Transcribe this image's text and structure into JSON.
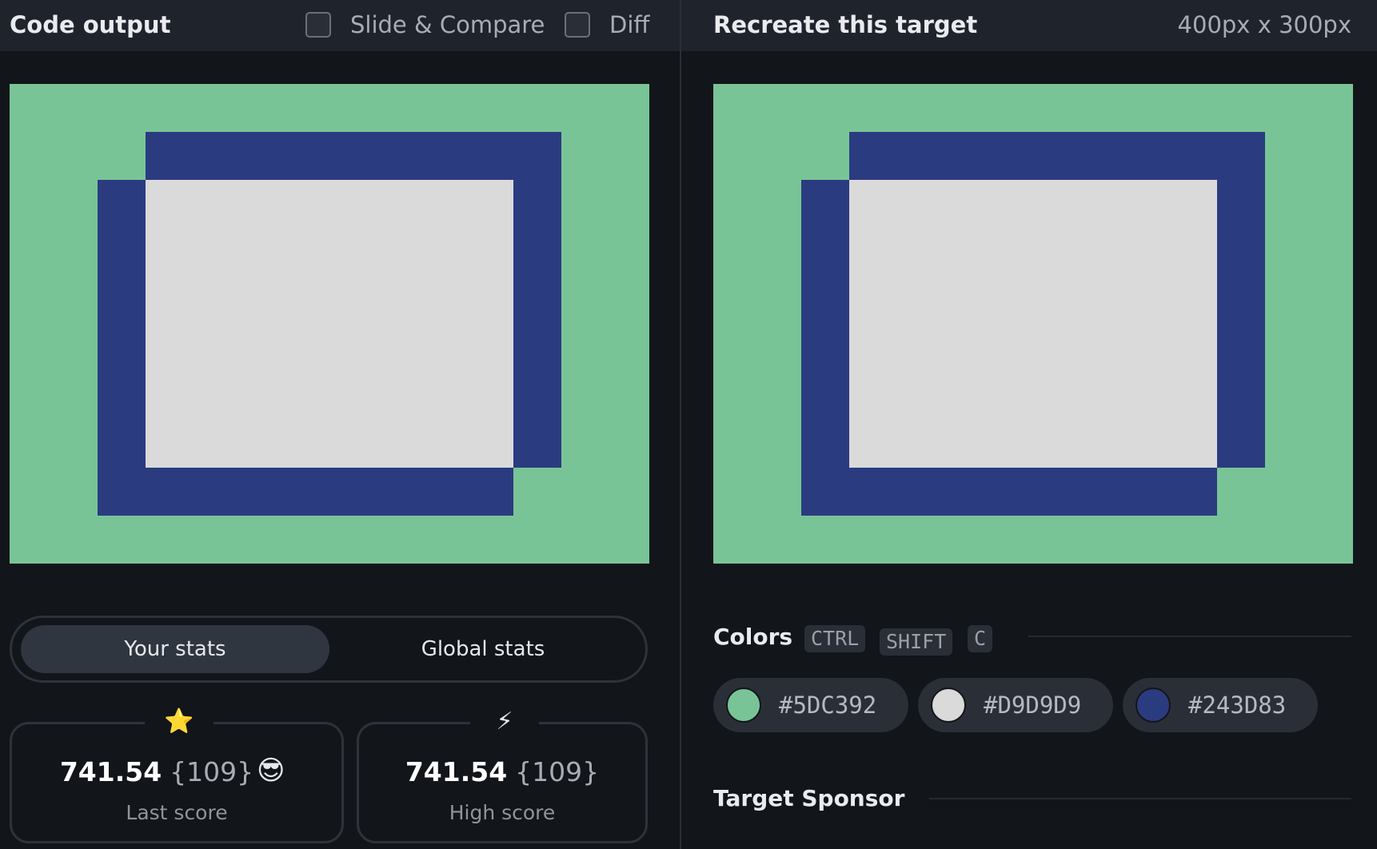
{
  "left": {
    "title": "Code output",
    "slide_compare_label": "Slide & Compare",
    "diff_label": "Diff"
  },
  "right": {
    "title": "Recreate this target",
    "dimensions": "400px x 300px"
  },
  "stats": {
    "tabs": {
      "your": "Your stats",
      "global": "Global stats"
    },
    "last": {
      "icon": "star-icon",
      "glyph": "⭐",
      "value": "741.54",
      "count": "{109}",
      "emoji": "😎",
      "label": "Last score"
    },
    "high": {
      "icon": "lightning-icon",
      "glyph": "⚡",
      "value": "741.54",
      "count": "{109}",
      "label": "High score"
    }
  },
  "colors": {
    "title": "Colors",
    "shortcut": [
      "CTRL",
      "SHIFT",
      "C"
    ],
    "swatches": [
      {
        "hex": "#5DC392",
        "color": "#5DC392"
      },
      {
        "hex": "#D9D9D9",
        "color": "#D9D9D9"
      },
      {
        "hex": "#243D83",
        "color": "#243D83"
      }
    ]
  },
  "sponsor": {
    "title": "Target Sponsor"
  },
  "palette": {
    "green": "#79c497",
    "gray": "#dadada",
    "navy": "#2b3b80"
  }
}
